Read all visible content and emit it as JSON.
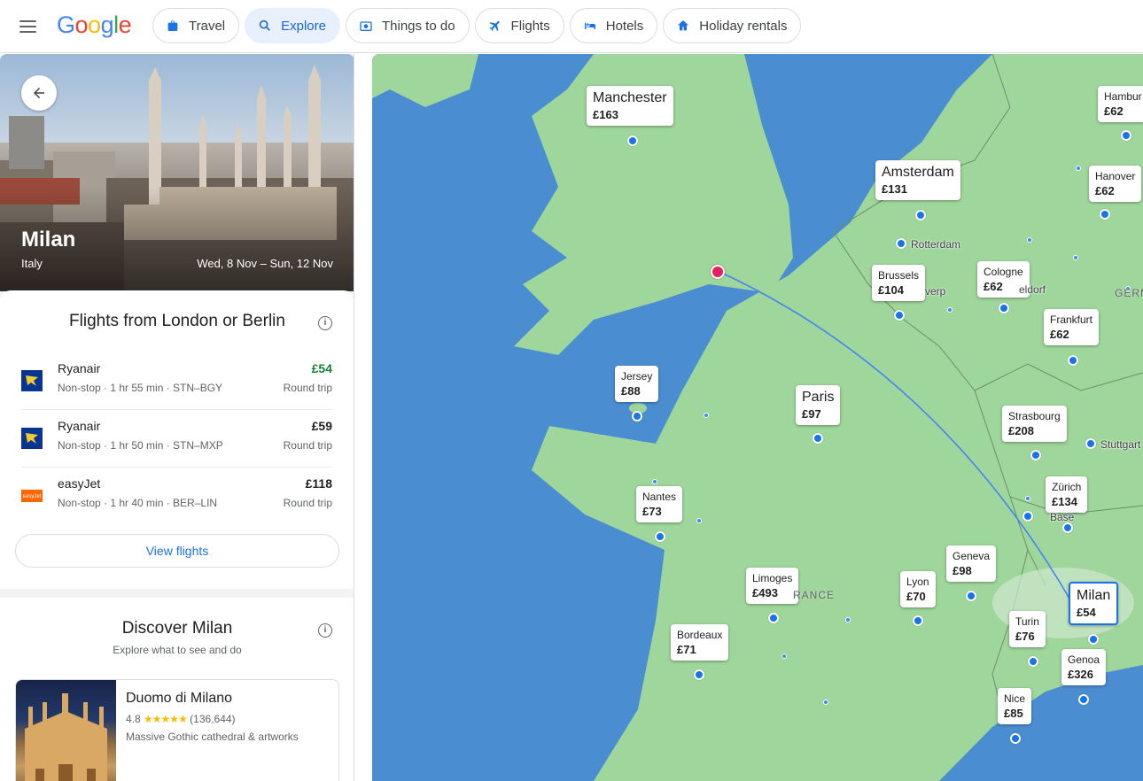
{
  "header": {
    "logo": [
      "G",
      "o",
      "o",
      "g",
      "l",
      "e"
    ],
    "logo_colors": [
      "#4285F4",
      "#EA4335",
      "#FBBC05",
      "#4285F4",
      "#34A853",
      "#EA4335"
    ],
    "tabs": [
      {
        "label": "Travel",
        "icon": "travel-bag-icon",
        "active": false
      },
      {
        "label": "Explore",
        "icon": "explore-search-icon",
        "active": true
      },
      {
        "label": "Things to do",
        "icon": "camera-icon",
        "active": false
      },
      {
        "label": "Flights",
        "icon": "plane-icon",
        "active": false
      },
      {
        "label": "Hotels",
        "icon": "bed-icon",
        "active": false
      },
      {
        "label": "Holiday rentals",
        "icon": "house-icon",
        "active": false
      }
    ]
  },
  "destination": {
    "city": "Milan",
    "country": "Italy",
    "dates": "Wed, 8 Nov – Sun, 12 Nov"
  },
  "flights": {
    "title": "Flights from London or Berlin",
    "items": [
      {
        "airline": "Ryanair",
        "details": "Non-stop · 1 hr 55 min · STN–BGY",
        "price": "£54",
        "type": "Round trip",
        "cheapest": true,
        "logo": "ryanair-logo"
      },
      {
        "airline": "Ryanair",
        "details": "Non-stop · 1 hr 50 min · STN–MXP",
        "price": "£59",
        "type": "Round trip",
        "cheapest": false,
        "logo": "ryanair-logo"
      },
      {
        "airline": "easyJet",
        "details": "Non-stop · 1 hr 40 min · BER–LIN",
        "price": "£118",
        "type": "Round trip",
        "cheapest": false,
        "logo": "easyjet-logo"
      }
    ],
    "view_button": "View flights"
  },
  "discover": {
    "title": "Discover Milan",
    "subtitle": "Explore what to see and do",
    "place": {
      "name": "Duomo di Milano",
      "rating": "4.8",
      "stars": "★★★★★",
      "reviews": "(136,644)",
      "description": "Massive Gothic cathedral & artworks"
    }
  },
  "map": {
    "colors": {
      "water": "#4a8ed1",
      "land": "#9fd69b",
      "route": "#4285f4",
      "origin": "#e91e63"
    },
    "labels": [
      {
        "id": "manchester",
        "name": "Manchester",
        "price": "£163",
        "size": "big"
      },
      {
        "id": "hamburg",
        "name": "Hambur",
        "price": "£62",
        "size": "small"
      },
      {
        "id": "amsterdam",
        "name": "Amsterdam",
        "price": "£131",
        "size": "big"
      },
      {
        "id": "hanover",
        "name": "Hanover",
        "price": "£62",
        "size": "small"
      },
      {
        "id": "brussels",
        "name": "Brussels",
        "price": "£104",
        "size": "small"
      },
      {
        "id": "cologne",
        "name": "Cologne",
        "price": "£62",
        "size": "small"
      },
      {
        "id": "frankfurt",
        "name": "Frankfurt",
        "price": "£62",
        "size": "small"
      },
      {
        "id": "jersey",
        "name": "Jersey",
        "price": "£88",
        "size": "small"
      },
      {
        "id": "paris",
        "name": "Paris",
        "price": "£97",
        "size": "big"
      },
      {
        "id": "strasbourg",
        "name": "Strasbourg",
        "price": "£208",
        "size": "small"
      },
      {
        "id": "zurich",
        "name": "Zürich",
        "price": "£134",
        "size": "small"
      },
      {
        "id": "nantes",
        "name": "Nantes",
        "price": "£73",
        "size": "small"
      },
      {
        "id": "geneva",
        "name": "Geneva",
        "price": "£98",
        "size": "small"
      },
      {
        "id": "limoges",
        "name": "Limoges",
        "price": "£493",
        "size": "small"
      },
      {
        "id": "lyon",
        "name": "Lyon",
        "price": "£70",
        "size": "small"
      },
      {
        "id": "milan",
        "name": "Milan",
        "price": "£54",
        "size": "big",
        "selected": true
      },
      {
        "id": "turin",
        "name": "Turin",
        "price": "£76",
        "size": "small"
      },
      {
        "id": "bordeaux",
        "name": "Bordeaux",
        "price": "£71",
        "size": "small"
      },
      {
        "id": "genoa",
        "name": "Genoa",
        "price": "£326",
        "size": "small"
      },
      {
        "id": "nice",
        "name": "Nice",
        "price": "£85",
        "size": "small"
      }
    ],
    "place_names": [
      "Rotterdam",
      "Düsseldorf",
      "Antwerp",
      "Stuttgart",
      "Basel"
    ],
    "place_names_display": [
      "Rotterdam",
      "eldorf",
      "verp",
      "Stuttgart",
      "Base"
    ],
    "regions": [
      "RANCE",
      "GERM"
    ]
  }
}
